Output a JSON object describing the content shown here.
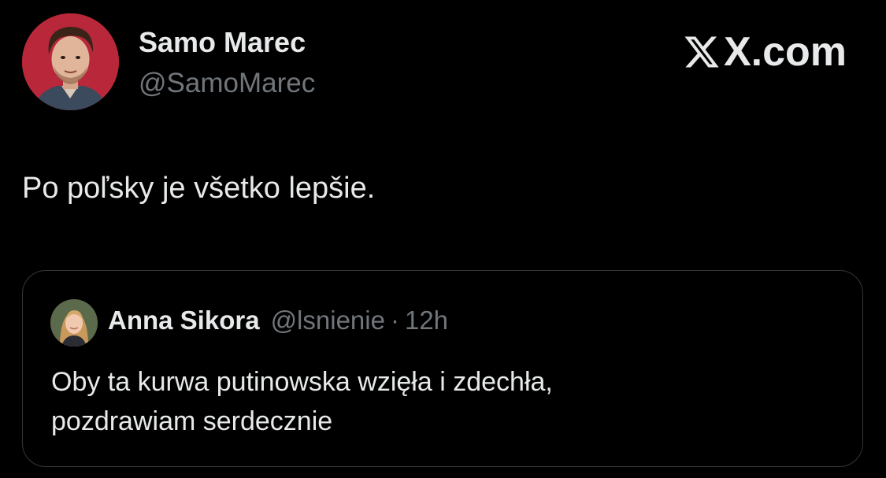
{
  "tweet": {
    "author": {
      "name": "Samo Marec",
      "handle": "@SamoMarec"
    },
    "brand": "X.com",
    "text": "Po poľsky je všetko lepšie.",
    "quote": {
      "author_name": "Anna Sikora",
      "author_handle": "@lsnienie",
      "separator": "·",
      "time": "12h",
      "text_lines": [
        "Oby ta kurwa putinowska wzięła i zdechła,",
        "pozdrawiam serdecznie"
      ]
    }
  },
  "colors": {
    "background": "#000000",
    "primary_text": "#e7e9ea",
    "secondary_text": "#71767b",
    "border": "#333639",
    "avatar_bg": "#b8283a"
  }
}
